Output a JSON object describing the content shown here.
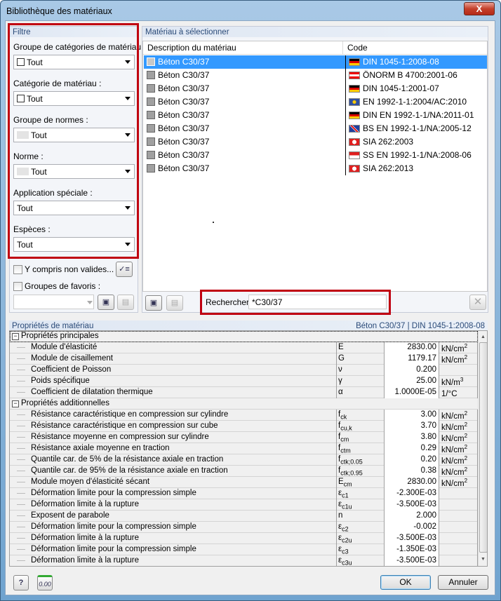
{
  "window": {
    "title": "Bibliothèque des matériaux",
    "close": "X"
  },
  "filter": {
    "header": "Filtre",
    "fields": [
      {
        "label": "Groupe de catégories de matériau :",
        "value": "Tout",
        "swatch": "checkbox"
      },
      {
        "label": "Catégorie de matériau :",
        "value": "Tout",
        "swatch": "checkbox"
      },
      {
        "label": "Groupe de normes :",
        "value": "Tout",
        "swatch": "gray"
      },
      {
        "label": "Norme :",
        "value": "Tout",
        "swatch": "gray"
      },
      {
        "label": "Application spéciale :",
        "value": "Tout",
        "swatch": "none"
      },
      {
        "label": "Espèces :",
        "value": "Tout",
        "swatch": "none"
      }
    ],
    "include_invalid": "Y compris non valides...",
    "favorites": "Groupes de favoris :",
    "favorites_value": ""
  },
  "materials": {
    "header": "Matériau à sélectionner",
    "columns": [
      "Description du matériau",
      "Code"
    ],
    "rows": [
      {
        "desc": "Béton C30/37",
        "code": "DIN 1045-1:2008-08",
        "flag": "germany",
        "selected": true
      },
      {
        "desc": "Béton C30/37",
        "code": "ÖNORM B 4700:2001-06",
        "flag": "austria"
      },
      {
        "desc": "Béton C30/37",
        "code": "DIN 1045-1:2001-07",
        "flag": "germany"
      },
      {
        "desc": "Béton C30/37",
        "code": "EN 1992-1-1:2004/AC:2010",
        "flag": "eu"
      },
      {
        "desc": "Béton C30/37",
        "code": "DIN EN 1992-1-1/NA:2011-01",
        "flag": "germany"
      },
      {
        "desc": "Béton C30/37",
        "code": "BS EN 1992-1-1/NA:2005-12",
        "flag": "uk"
      },
      {
        "desc": "Béton C30/37",
        "code": "SIA 262:2003",
        "flag": "switzerland"
      },
      {
        "desc": "Béton C30/37",
        "code": "SS EN 1992-1-1/NA:2008-06",
        "flag": "singapore"
      },
      {
        "desc": "Béton C30/37",
        "code": "SIA 262:2013",
        "flag": "switzerland"
      }
    ],
    "search_label": "Rechercher",
    "search_value": "*C30/37"
  },
  "properties": {
    "header": "Propriétés de matériau",
    "selection": "Béton C30/37  |  DIN 1045-1:2008-08",
    "rows": [
      {
        "group": "Propriétés principales"
      },
      {
        "name": "Module d'élasticité",
        "sym": "E",
        "sub": "",
        "val": "2830.00",
        "unit": "kN/cm",
        "sup": "2"
      },
      {
        "name": "Module de cisaillement",
        "sym": "G",
        "sub": "",
        "val": "1179.17",
        "unit": "kN/cm",
        "sup": "2"
      },
      {
        "name": "Coefficient de Poisson",
        "sym": "ν",
        "sub": "",
        "val": "0.200",
        "unit": "",
        "sup": ""
      },
      {
        "name": "Poids spécifique",
        "sym": "γ",
        "sub": "",
        "val": "25.00",
        "unit": "kN/m",
        "sup": "3"
      },
      {
        "name": "Coefficient de dilatation thermique",
        "sym": "α",
        "sub": "",
        "val": "1.0000E-05",
        "unit": "1/°C",
        "sup": ""
      },
      {
        "group": "Propriétés additionnelles"
      },
      {
        "name": "Résistance caractéristique en compression sur cylindre",
        "sym": "f",
        "sub": "ck",
        "val": "3.00",
        "unit": "kN/cm",
        "sup": "2"
      },
      {
        "name": "Résistance caractéristique en compression sur cube",
        "sym": "f",
        "sub": "cu,k",
        "val": "3.70",
        "unit": "kN/cm",
        "sup": "2"
      },
      {
        "name": "Résistance moyenne en compression sur cylindre",
        "sym": "f",
        "sub": "cm",
        "val": "3.80",
        "unit": "kN/cm",
        "sup": "2"
      },
      {
        "name": "Résistance axiale moyenne en traction",
        "sym": "f",
        "sub": "ctm",
        "val": "0.29",
        "unit": "kN/cm",
        "sup": "2"
      },
      {
        "name": "Quantile car. de 5% de la résistance axiale en traction",
        "sym": "f",
        "sub": "ctk;0.05",
        "val": "0.20",
        "unit": "kN/cm",
        "sup": "2"
      },
      {
        "name": "Quantile car. de 95% de la résistance axiale en traction",
        "sym": "f",
        "sub": "ctk;0.95",
        "val": "0.38",
        "unit": "kN/cm",
        "sup": "2"
      },
      {
        "name": "Module moyen d'élasticité sécant",
        "sym": "E",
        "sub": "cm",
        "val": "2830.00",
        "unit": "kN/cm",
        "sup": "2"
      },
      {
        "name": "Déformation limite pour la compression simple",
        "sym": "ε",
        "sub": "c1",
        "val": "-2.300E-03",
        "unit": "",
        "sup": ""
      },
      {
        "name": "Déformation limite à la rupture",
        "sym": "ε",
        "sub": "c1u",
        "val": "-3.500E-03",
        "unit": "",
        "sup": ""
      },
      {
        "name": "Exposent de parabole",
        "sym": "n",
        "sub": "",
        "val": "2.000",
        "unit": "",
        "sup": ""
      },
      {
        "name": "Déformation limite pour la compression simple",
        "sym": "ε",
        "sub": "c2",
        "val": "-0.002",
        "unit": "",
        "sup": ""
      },
      {
        "name": "Déformation limite à la rupture",
        "sym": "ε",
        "sub": "c2u",
        "val": "-3.500E-03",
        "unit": "",
        "sup": ""
      },
      {
        "name": "Déformation limite pour la compression simple",
        "sym": "ε",
        "sub": "c3",
        "val": "-1.350E-03",
        "unit": "",
        "sup": ""
      },
      {
        "name": "Déformation limite à la rupture",
        "sym": "ε",
        "sub": "c3u",
        "val": "-3.500E-03",
        "unit": "",
        "sup": ""
      }
    ]
  },
  "footer": {
    "ok": "OK",
    "cancel": "Annuler",
    "units_icon_text": "0.00"
  },
  "colors": {
    "selection": "#3399ff",
    "highlight_box": "#c00010",
    "panel_header": "#2a4a78"
  }
}
